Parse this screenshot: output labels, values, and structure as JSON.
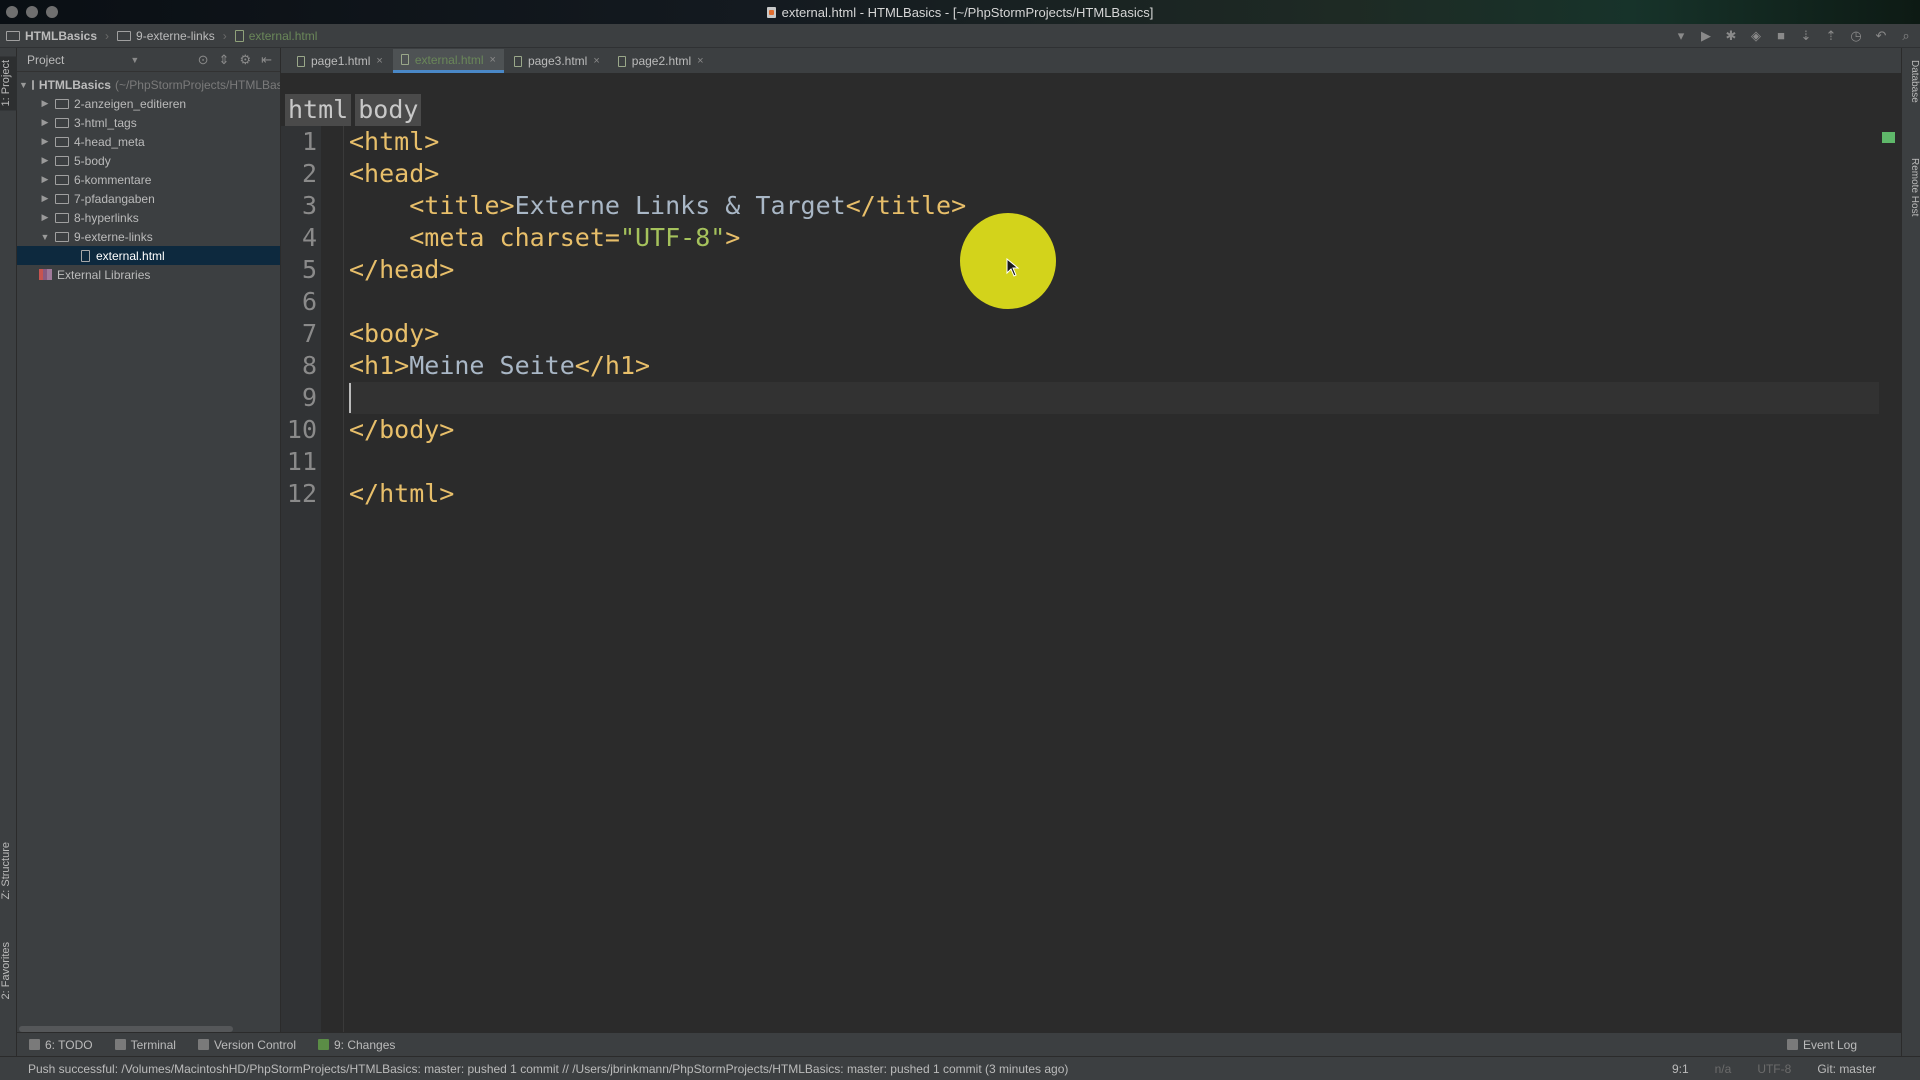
{
  "window": {
    "title": "external.html - HTMLBasics - [~/PhpStormProjects/HTMLBasics]"
  },
  "navbar": {
    "crumbs": [
      "HTMLBasics",
      "9-externe-links",
      "external.html"
    ]
  },
  "left_strip": {
    "project_tab": "1: Project",
    "structure_tab": "Z: Structure",
    "favorites_tab": "2: Favorites"
  },
  "right_strip": {
    "database_tab": "Database",
    "remote_host_tab": "Remote Host"
  },
  "project_panel": {
    "header": "Project",
    "tree": [
      {
        "label": "HTMLBasics",
        "path": "(~/PhpStormProjects/HTMLBasics)",
        "kind": "folder",
        "expanded": true
      },
      {
        "label": "2-anzeigen_editieren",
        "kind": "folder"
      },
      {
        "label": "3-html_tags",
        "kind": "folder"
      },
      {
        "label": "4-head_meta",
        "kind": "folder"
      },
      {
        "label": "5-body",
        "kind": "folder"
      },
      {
        "label": "6-kommentare",
        "kind": "folder"
      },
      {
        "label": "7-pfadangaben",
        "kind": "folder"
      },
      {
        "label": "8-hyperlinks",
        "kind": "folder"
      },
      {
        "label": "9-externe-links",
        "kind": "folder",
        "expanded": true
      },
      {
        "label": "external.html",
        "kind": "file",
        "selected": true
      },
      {
        "label": "External Libraries",
        "kind": "library"
      }
    ]
  },
  "tabs": [
    {
      "label": "page1.html",
      "active": false
    },
    {
      "label": "external.html",
      "active": true
    },
    {
      "label": "page3.html",
      "active": false
    },
    {
      "label": "page2.html",
      "active": false
    }
  ],
  "editor": {
    "breadcrumb": [
      "html",
      "body"
    ],
    "line_numbers": [
      "1",
      "2",
      "3",
      "4",
      "5",
      "6",
      "7",
      "8",
      "9",
      "10",
      "11",
      "12"
    ],
    "lines": [
      {
        "segments": [
          {
            "t": "<html>",
            "c": "tag"
          }
        ]
      },
      {
        "segments": [
          {
            "t": "<head>",
            "c": "tag"
          }
        ]
      },
      {
        "segments": [
          {
            "t": "    "
          },
          {
            "t": "<title>",
            "c": "tag"
          },
          {
            "t": "Externe Links & Target",
            "c": "txt"
          },
          {
            "t": "</title>",
            "c": "tag"
          }
        ]
      },
      {
        "segments": [
          {
            "t": "    "
          },
          {
            "t": "<meta charset=",
            "c": "tag"
          },
          {
            "t": "\"UTF-8\"",
            "c": "str"
          },
          {
            "t": ">",
            "c": "tag"
          }
        ]
      },
      {
        "segments": [
          {
            "t": "</head>",
            "c": "tag"
          }
        ]
      },
      {
        "segments": []
      },
      {
        "segments": [
          {
            "t": "<body>",
            "c": "tag"
          }
        ]
      },
      {
        "segments": [
          {
            "t": "<h1>",
            "c": "tag"
          },
          {
            "t": "Meine Seite",
            "c": "txt"
          },
          {
            "t": "</h1>",
            "c": "tag"
          }
        ]
      },
      {
        "segments": [],
        "current": true
      },
      {
        "segments": [
          {
            "t": "</body>",
            "c": "tag"
          }
        ]
      },
      {
        "segments": []
      },
      {
        "segments": [
          {
            "t": "</html>",
            "c": "tag"
          }
        ]
      }
    ],
    "colors": {
      "tag": "#e8bf6a",
      "text": "#a9b7c6",
      "string": "#a5c25c",
      "background": "#2b2b2b"
    }
  },
  "bottom_tools": [
    {
      "label": "6: TODO",
      "icon": "todo-icon"
    },
    {
      "label": "Terminal",
      "icon": "terminal-icon"
    },
    {
      "label": "Version Control",
      "icon": "version-control-icon"
    },
    {
      "label": "9: Changes",
      "icon": "changes-icon"
    }
  ],
  "event_log": "Event Log",
  "status": {
    "message": "Push successful: /Volumes/MacintoshHD/PhpStormProjects/HTMLBasics: master: pushed 1 commit // /Users/jbrinkmann/PhpStormProjects/HTMLBasics: master: pushed 1 commit (3 minutes ago)",
    "position": "9:1",
    "line_sep": "n/a",
    "encoding": "UTF-8",
    "vcs": "Git: master"
  }
}
